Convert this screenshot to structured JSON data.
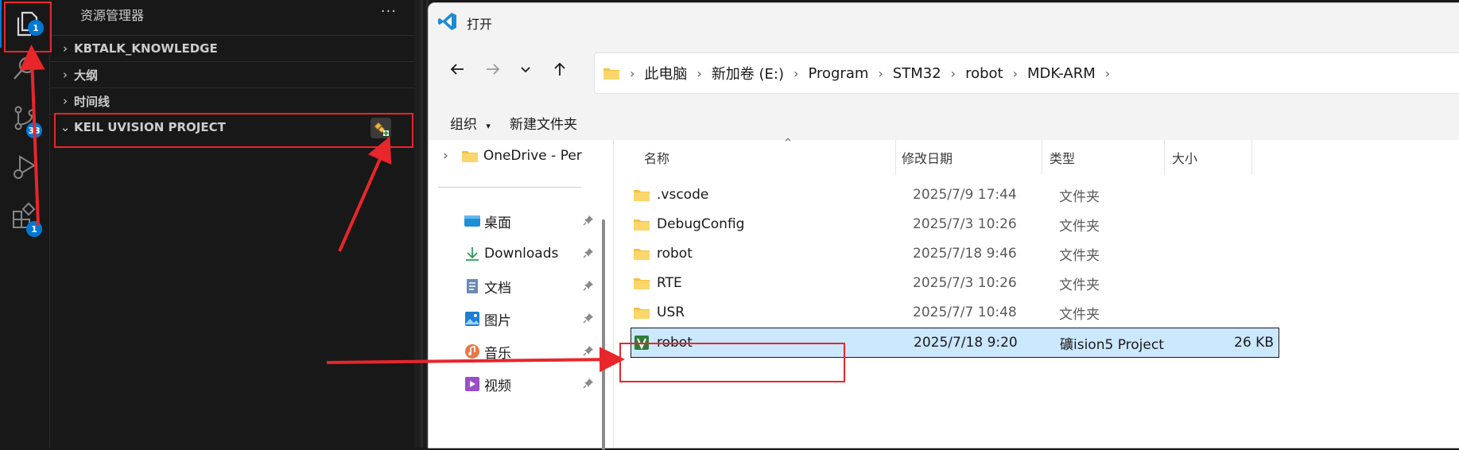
{
  "vscode": {
    "activity_badges": {
      "explorer": "1",
      "scm": "33",
      "extensions": "1"
    },
    "sidebar_title": "资源管理器",
    "more_actions": "···",
    "sections": [
      {
        "label": "KBTALK_KNOWLEDGE",
        "chevron": "›"
      },
      {
        "label": "大纲",
        "chevron": "›"
      },
      {
        "label": "时间线",
        "chevron": "›"
      },
      {
        "label": "KEIL UVISION PROJECT",
        "chevron": "⌄"
      }
    ]
  },
  "dialog": {
    "title": "打开",
    "breadcrumb": [
      "此电脑",
      "新加卷 (E:)",
      "Program",
      "STM32",
      "robot",
      "MDK-ARM"
    ],
    "commands": {
      "organize": "组织",
      "new_folder": "新建文件夹"
    },
    "nav_pane": {
      "onedrive": "OneDrive - Per",
      "items": [
        "桌面",
        "Downloads",
        "文档",
        "图片",
        "音乐",
        "视频"
      ]
    },
    "columns": [
      "名称",
      "修改日期",
      "类型",
      "大小"
    ],
    "files": [
      {
        "name": ".vscode",
        "date": "2025/7/9 17:44",
        "type": "文件夹",
        "size": ""
      },
      {
        "name": "DebugConfig",
        "date": "2025/7/3 10:26",
        "type": "文件夹",
        "size": ""
      },
      {
        "name": "robot",
        "date": "2025/7/18 9:46",
        "type": "文件夹",
        "size": ""
      },
      {
        "name": "RTE",
        "date": "2025/7/3 10:26",
        "type": "文件夹",
        "size": ""
      },
      {
        "name": "USR",
        "date": "2025/7/7 10:48",
        "type": "文件夹",
        "size": ""
      },
      {
        "name": "robot",
        "date": "2025/7/18 9:20",
        "type": "礦ision5 Project",
        "size": "26 KB"
      }
    ]
  },
  "colors": {
    "vscode_bg": "#181818",
    "badge_blue": "#0078d4",
    "annotation_red": "#e8262b",
    "selection_bg": "#cce8ff",
    "folder_yellow": "#f5c242"
  }
}
